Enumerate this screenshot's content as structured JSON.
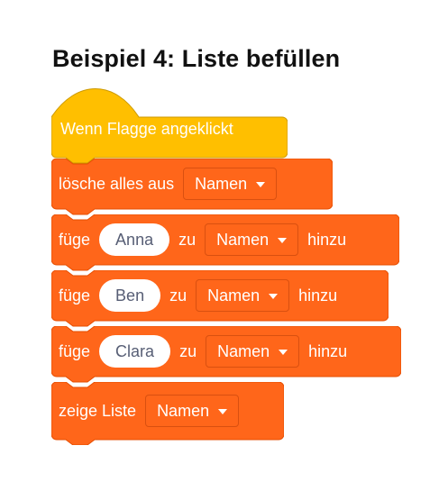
{
  "title": "Beispiel 4: Liste befüllen",
  "colors": {
    "event": "#ffbf00",
    "event_border": "#cc9900",
    "list": "#ff661a",
    "list_border": "#e64d00"
  },
  "hat": {
    "label": "Wenn Flagge angeklickt"
  },
  "blocks": [
    {
      "label": "lösche alles aus",
      "list": "Namen"
    },
    {
      "label": "füge",
      "value": "Anna",
      "zu": "zu",
      "list": "Namen",
      "suffix": "hinzu"
    },
    {
      "label": "füge",
      "value": "Ben",
      "zu": "zu",
      "list": "Namen",
      "suffix": "hinzu"
    },
    {
      "label": "füge",
      "value": "Clara",
      "zu": "zu",
      "list": "Namen",
      "suffix": "hinzu"
    },
    {
      "label": "zeige Liste",
      "list": "Namen"
    }
  ]
}
